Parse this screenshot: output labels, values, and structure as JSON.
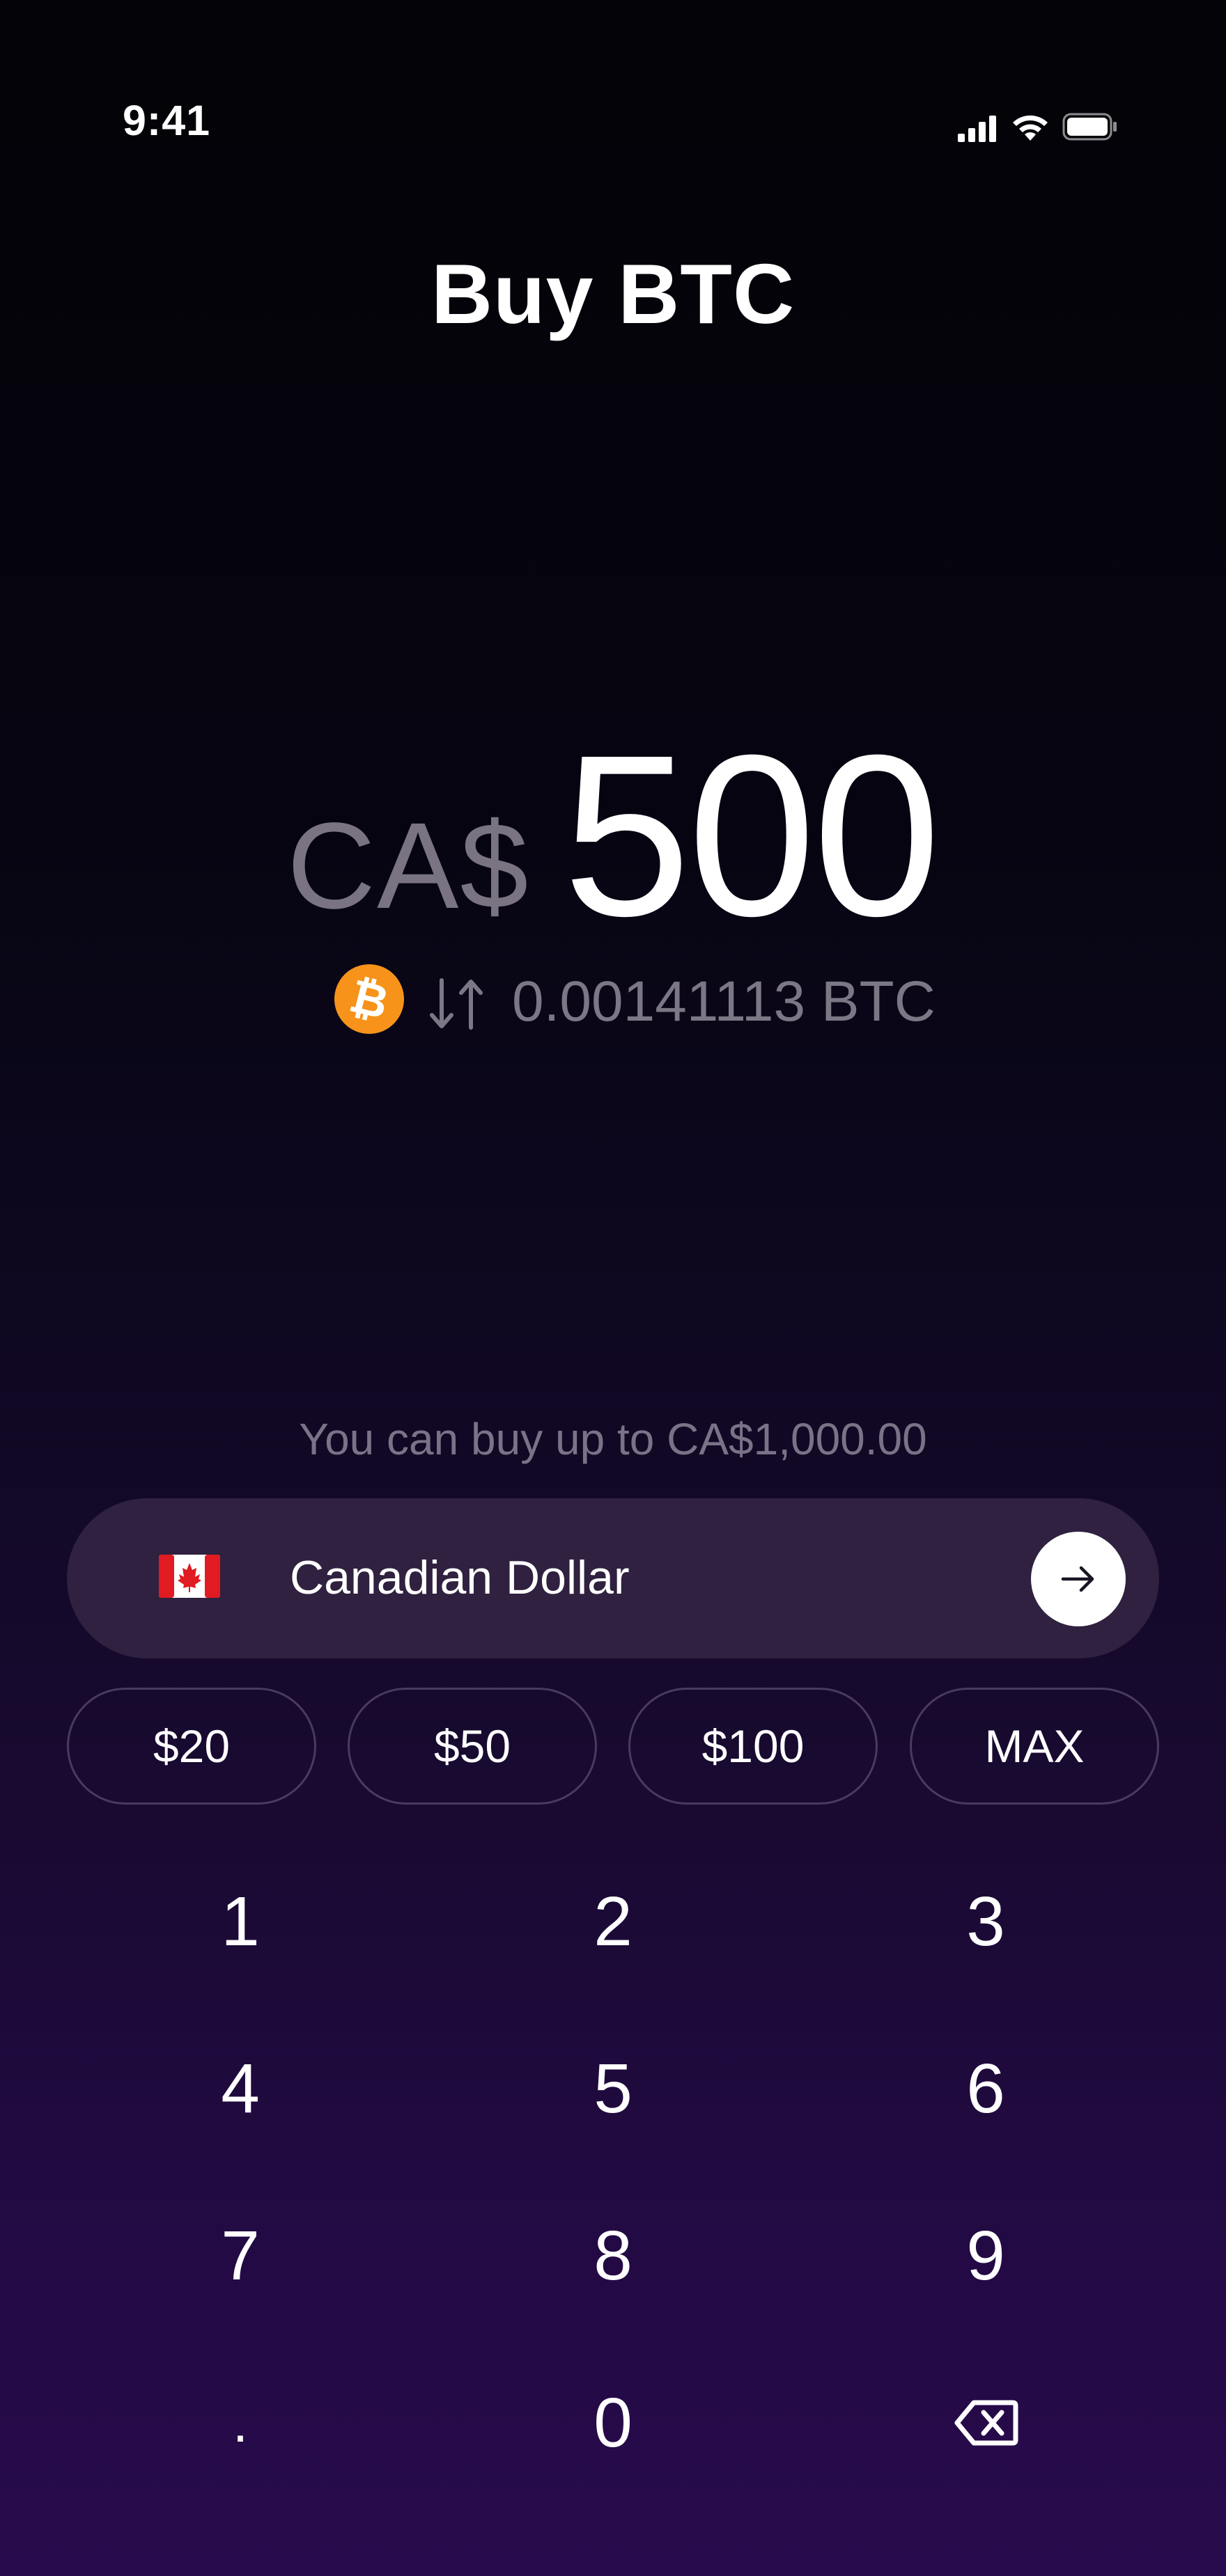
{
  "status_bar": {
    "time": "9:41",
    "icons": [
      "signal-icon",
      "wifi-icon",
      "battery-icon"
    ]
  },
  "header": {
    "title": "Buy BTC"
  },
  "amount": {
    "currency_prefix": "CA$",
    "value": "500",
    "conversion_text": "0.00141113 BTC",
    "coin_icon": "bitcoin-icon",
    "swap_icon": "swap-arrows-icon"
  },
  "limit": {
    "text": "You can buy up to CA$1,000.00"
  },
  "currency_selector": {
    "flag_icon": "canada-flag-icon",
    "name": "Canadian Dollar",
    "next_icon": "arrow-right-icon"
  },
  "quick_amounts": [
    "$20",
    "$50",
    "$100",
    "MAX"
  ],
  "keypad": {
    "keys": [
      "1",
      "2",
      "3",
      "4",
      "5",
      "6",
      "7",
      "8",
      "9",
      ".",
      "0"
    ],
    "backspace_icon": "backspace-icon"
  },
  "colors": {
    "bitcoin_orange": "#f7931a",
    "selector_bg": "#2f213f",
    "muted_text": "#7a7388",
    "background_bottom": "#280b4c"
  }
}
